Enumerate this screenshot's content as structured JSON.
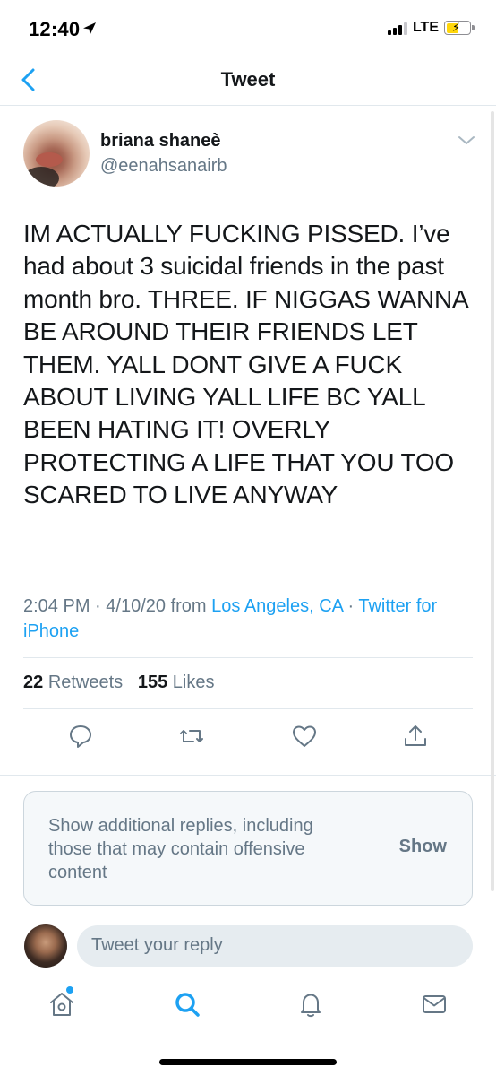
{
  "status_bar": {
    "time": "12:40",
    "network": "LTE"
  },
  "nav": {
    "title": "Tweet"
  },
  "tweet": {
    "display_name": "briana shaneè",
    "handle": "@eenahsanairb",
    "text": "IM ACTUALLY FUCKING PISSED. I’ve had about 3 suicidal friends in the past month bro. THREE. IF NIGGAS WANNA BE AROUND THEIR FRIENDS LET THEM. YALL DONT GIVE A FUCK ABOUT LIVING YALL LIFE BC YALL BEEN HATING IT! OVERLY PROTECTING A LIFE THAT YOU TOO SCARED TO LIVE ANYWAY",
    "time": "2:04 PM",
    "date": "4/10/20",
    "from_label": "from",
    "location": "Los Angeles, CA",
    "source": "Twitter for iPhone",
    "separator": "·"
  },
  "stats": {
    "retweets_count": "22",
    "retweets_label": "Retweets",
    "likes_count": "155",
    "likes_label": "Likes"
  },
  "actions": [
    "reply-icon",
    "retweet-icon",
    "like-icon",
    "share-icon"
  ],
  "notice": {
    "text": "Show additional replies, including those that may contain offensive content",
    "button": "Show"
  },
  "reply": {
    "placeholder": "Tweet your reply"
  },
  "tab_bar": [
    "home-icon",
    "search-icon",
    "notifications-icon",
    "messages-icon"
  ],
  "colors": {
    "accent": "#1da1f2",
    "text": "#14171a",
    "secondary": "#657786",
    "border": "#e1e8ed"
  }
}
